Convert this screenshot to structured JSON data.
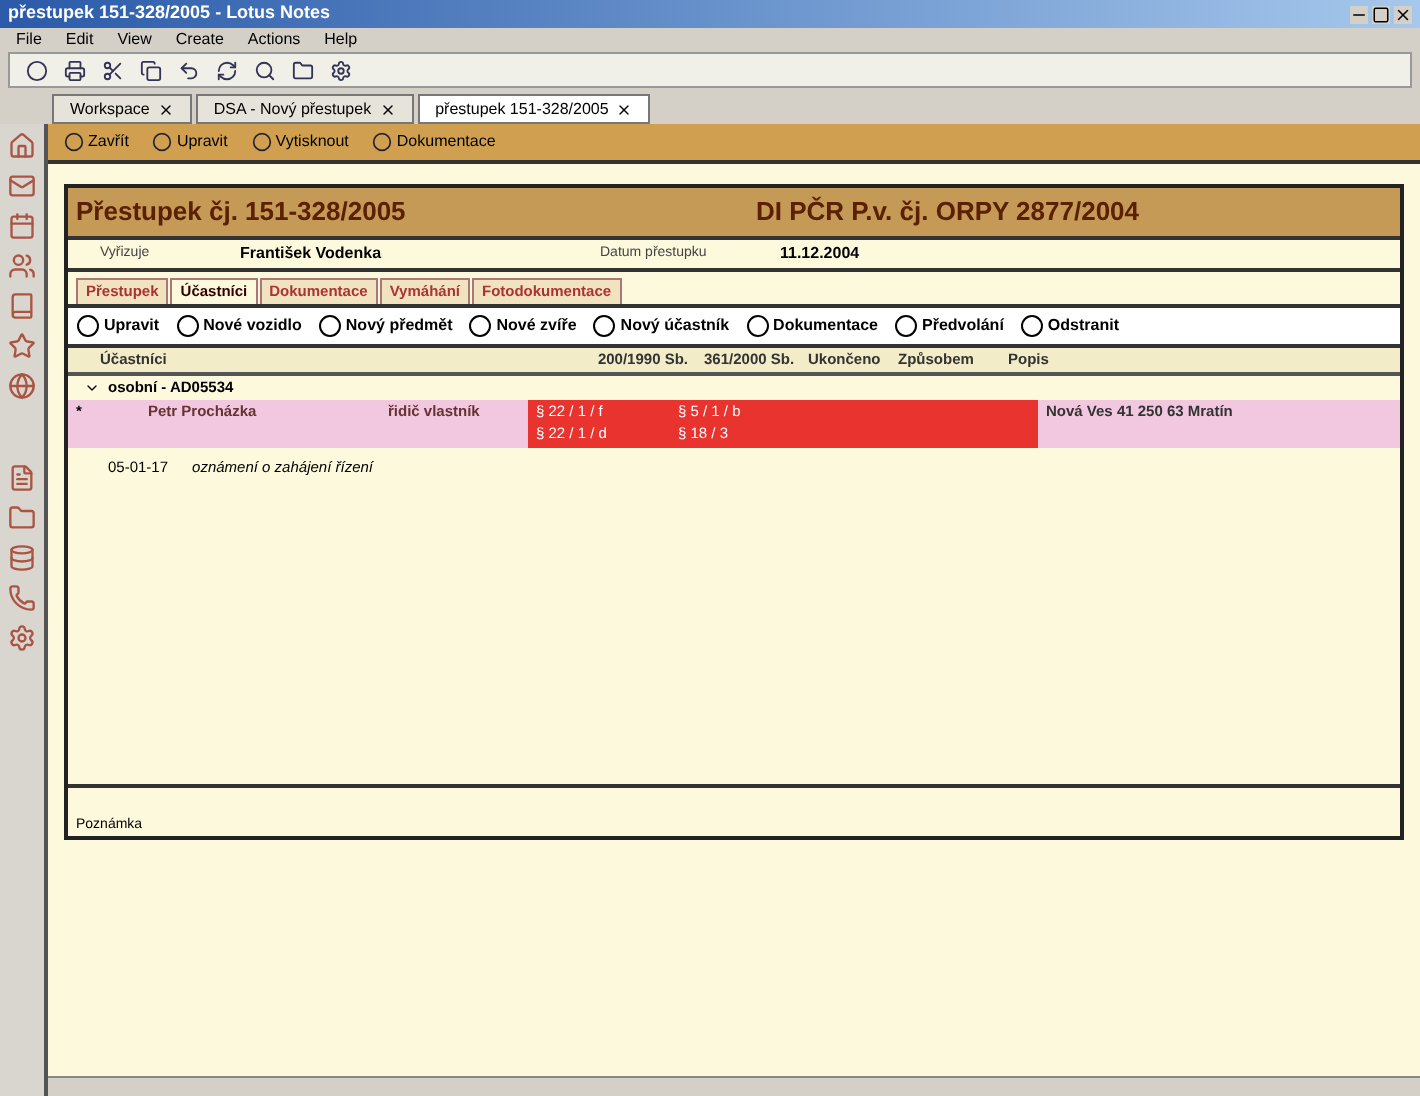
{
  "window": {
    "title": "přestupek 151-328/2005 - Lotus Notes"
  },
  "menu": [
    "File",
    "Edit",
    "View",
    "Create",
    "Actions",
    "Help"
  ],
  "tabs": [
    {
      "label": "Workspace",
      "selected": false
    },
    {
      "label": "DSA - Nový přestupek",
      "selected": false
    },
    {
      "label": "přestupek 151-328/2005",
      "selected": true
    }
  ],
  "action_bar": [
    "Zavřít",
    "Upravit",
    "Vytisknout",
    "Dokumentace"
  ],
  "form": {
    "title_left": "Přestupek čj. 151-328/2005",
    "title_right": "DI PČR P.v. čj. ORPY 2877/2004",
    "fields": [
      {
        "label": "Vyřizuje",
        "value": "František Vodenka"
      },
      {
        "label": "Datum přestupku",
        "value": "11.12.2004"
      }
    ],
    "tabs": [
      {
        "label": "Přestupek",
        "selected": false
      },
      {
        "label": "Účastníci",
        "selected": true
      },
      {
        "label": "Dokumentace",
        "selected": false
      },
      {
        "label": "Vymáhání",
        "selected": false
      },
      {
        "label": "Fotodokumentace",
        "selected": false
      }
    ],
    "buttons": [
      "Upravit",
      "Nové vozidlo",
      "Nový předmět",
      "Nové zvíře",
      "Nový účastník",
      "Dokumentace",
      "Předvolání",
      "Odstranit"
    ],
    "table": {
      "columns": [
        "Účastníci",
        "200/1990 Sb.",
        "361/2000 Sb.",
        "Ukončeno",
        "Způsobem",
        "Popis"
      ],
      "category": "osobní - AD05534",
      "rows": [
        {
          "marker": "*",
          "name": "Petr Procházka",
          "role": "řidič vlastník",
          "law_1990": [
            "§ 22 / 1 / f",
            "§ 22 / 1 / d"
          ],
          "law_2000": [
            "§ 5 / 1 / b",
            "§ 18 / 3"
          ],
          "address": "Nová Ves 41 250 63 Mratín",
          "highlighted": true
        }
      ],
      "note_row": {
        "date": "05-01-17",
        "text": "oznámení o zahájení řízení"
      }
    },
    "note_label": "Poznámka"
  }
}
